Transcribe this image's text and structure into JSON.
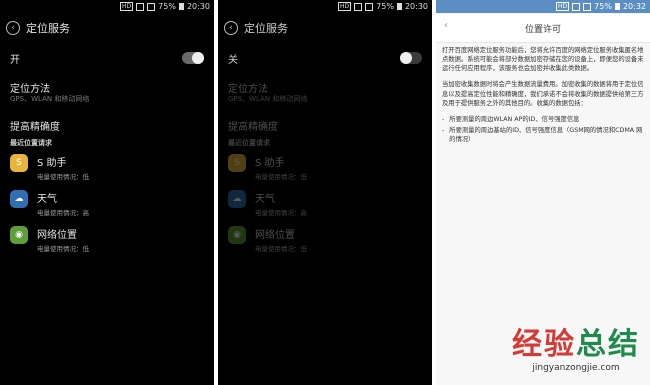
{
  "status_left": {
    "time": "20:30",
    "battery": "75%",
    "badge": "HD"
  },
  "status_mid": {
    "time": "20:30",
    "battery": "75%",
    "badge": "HD"
  },
  "status_right": {
    "time": "20:32",
    "battery": "75%",
    "badge": "HD"
  },
  "screen1": {
    "title": "定位服务",
    "toggle_label": "开",
    "toggle_state": "on",
    "method_title": "定位方法",
    "method_sub": "GPS、WLAN 和移动网络",
    "accuracy": "提高精确度",
    "recent": "最近位置请求",
    "apps": [
      {
        "name": "S 助手",
        "sub": "电量使用情况：低",
        "icon": "assistant-icon"
      },
      {
        "name": "天气",
        "sub": "电量使用情况：高",
        "icon": "weather-icon"
      },
      {
        "name": "网络位置",
        "sub": "电量使用情况：低",
        "icon": "android-icon"
      }
    ]
  },
  "screen2": {
    "title": "定位服务",
    "toggle_label": "关",
    "toggle_state": "off",
    "method_title": "定位方法",
    "method_sub": "GPS、WLAN 和移动网络",
    "accuracy": "提高精确度",
    "recent": "最近位置请求",
    "apps": [
      {
        "name": "S 助手",
        "sub": "电量使用情况：低"
      },
      {
        "name": "天气",
        "sub": "电量使用情况：高"
      },
      {
        "name": "网络位置",
        "sub": "电量使用情况：低"
      }
    ]
  },
  "screen3": {
    "title": "位置许可",
    "para1": "打开百度网络定位服务功能后，您将允许百度的网络定位服务收集匿名地点数据。系统可能会将部分数据加密存储在您的设备上，即便您的设备未运行任何应用程序，该服务也会加密并收集此类数据。",
    "para2": "当加密收集数据时将会产生数据流量费用。加密收集的数据将用于定位信息以及提高定位性能和精确度，我们承诺不会将收集的数据提供给第三方及用于提供服务之外的其他目的。收集的数据包括：",
    "bullets": [
      "所要测量的周边WLAN AP的ID、信号强度信息",
      "所要测量的周边基站的ID、信号强度信息（GSM网的情况和CDMA 网的情况）"
    ]
  },
  "watermark": {
    "logo_part1": "经验",
    "logo_part2": "总结",
    "url": "jingyanzongjie.com"
  }
}
